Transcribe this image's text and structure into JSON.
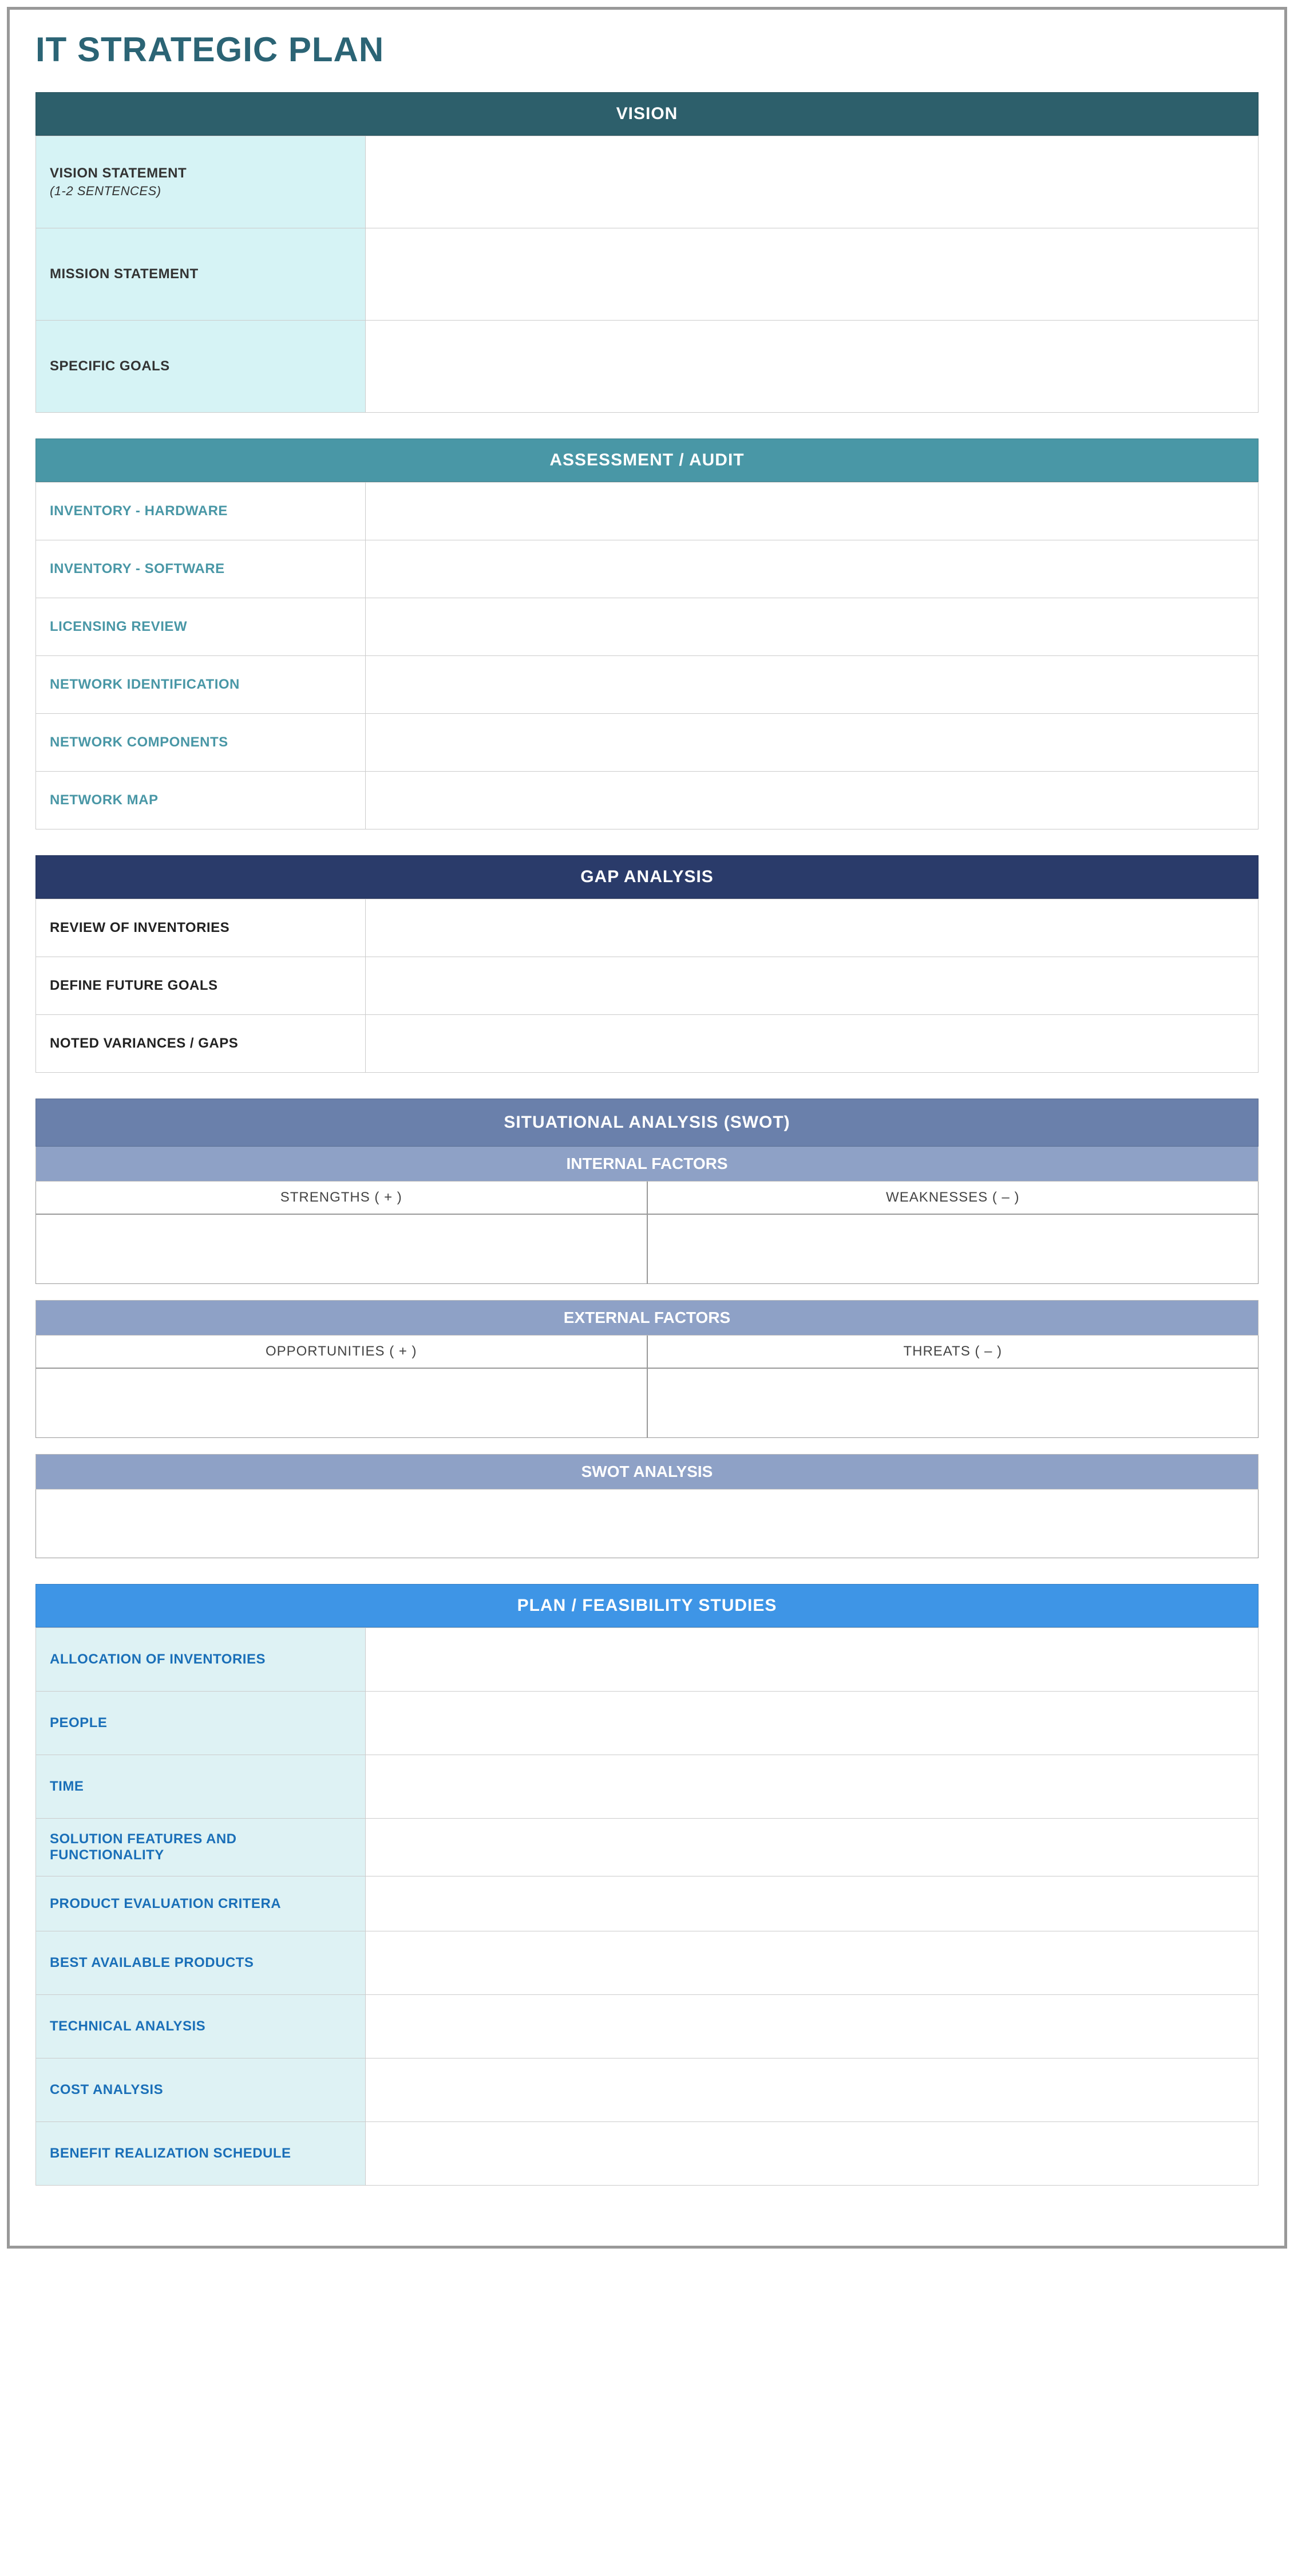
{
  "title": "IT STRATEGIC PLAN",
  "vision": {
    "header": "VISION",
    "rows": [
      {
        "label": "VISION STATEMENT",
        "sub": "(1-2 SENTENCES)",
        "value": ""
      },
      {
        "label": "MISSION STATEMENT",
        "sub": "",
        "value": ""
      },
      {
        "label": "SPECIFIC GOALS",
        "sub": "",
        "value": ""
      }
    ]
  },
  "assessment": {
    "header": "ASSESSMENT / AUDIT",
    "rows": [
      {
        "label": "INVENTORY - HARDWARE",
        "value": ""
      },
      {
        "label": "INVENTORY - SOFTWARE",
        "value": ""
      },
      {
        "label": "LICENSING REVIEW",
        "value": ""
      },
      {
        "label": "NETWORK IDENTIFICATION",
        "value": ""
      },
      {
        "label": "NETWORK COMPONENTS",
        "value": ""
      },
      {
        "label": "NETWORK MAP",
        "value": ""
      }
    ]
  },
  "gap": {
    "header": "GAP ANALYSIS",
    "rows": [
      {
        "label": "REVIEW OF INVENTORIES",
        "value": ""
      },
      {
        "label": "DEFINE FUTURE GOALS",
        "value": ""
      },
      {
        "label": "NOTED VARIANCES / GAPS",
        "value": ""
      }
    ]
  },
  "swot": {
    "header": "SITUATIONAL ANALYSIS (SWOT)",
    "internal": {
      "header": "INTERNAL FACTORS",
      "left": "STRENGTHS ( + )",
      "right": "WEAKNESSES ( – )",
      "leftBody": "",
      "rightBody": ""
    },
    "external": {
      "header": "EXTERNAL FACTORS",
      "left": "OPPORTUNITIES ( + )",
      "right": "THREATS ( – )",
      "leftBody": "",
      "rightBody": ""
    },
    "analysis": {
      "header": "SWOT ANALYSIS",
      "body": ""
    }
  },
  "plan": {
    "header": "PLAN / FEASIBILITY STUDIES",
    "rows": [
      {
        "label": "ALLOCATION OF INVENTORIES",
        "value": ""
      },
      {
        "label": "PEOPLE",
        "value": ""
      },
      {
        "label": "TIME",
        "value": ""
      },
      {
        "label": "SOLUTION FEATURES AND FUNCTIONALITY",
        "value": ""
      },
      {
        "label": "PRODUCT EVALUATION CRITERA",
        "value": ""
      },
      {
        "label": "BEST AVAILABLE PRODUCTS",
        "value": ""
      },
      {
        "label": "TECHNICAL ANALYSIS",
        "value": ""
      },
      {
        "label": "COST ANALYSIS",
        "value": ""
      },
      {
        "label": "BENEFIT REALIZATION SCHEDULE",
        "value": ""
      }
    ]
  }
}
